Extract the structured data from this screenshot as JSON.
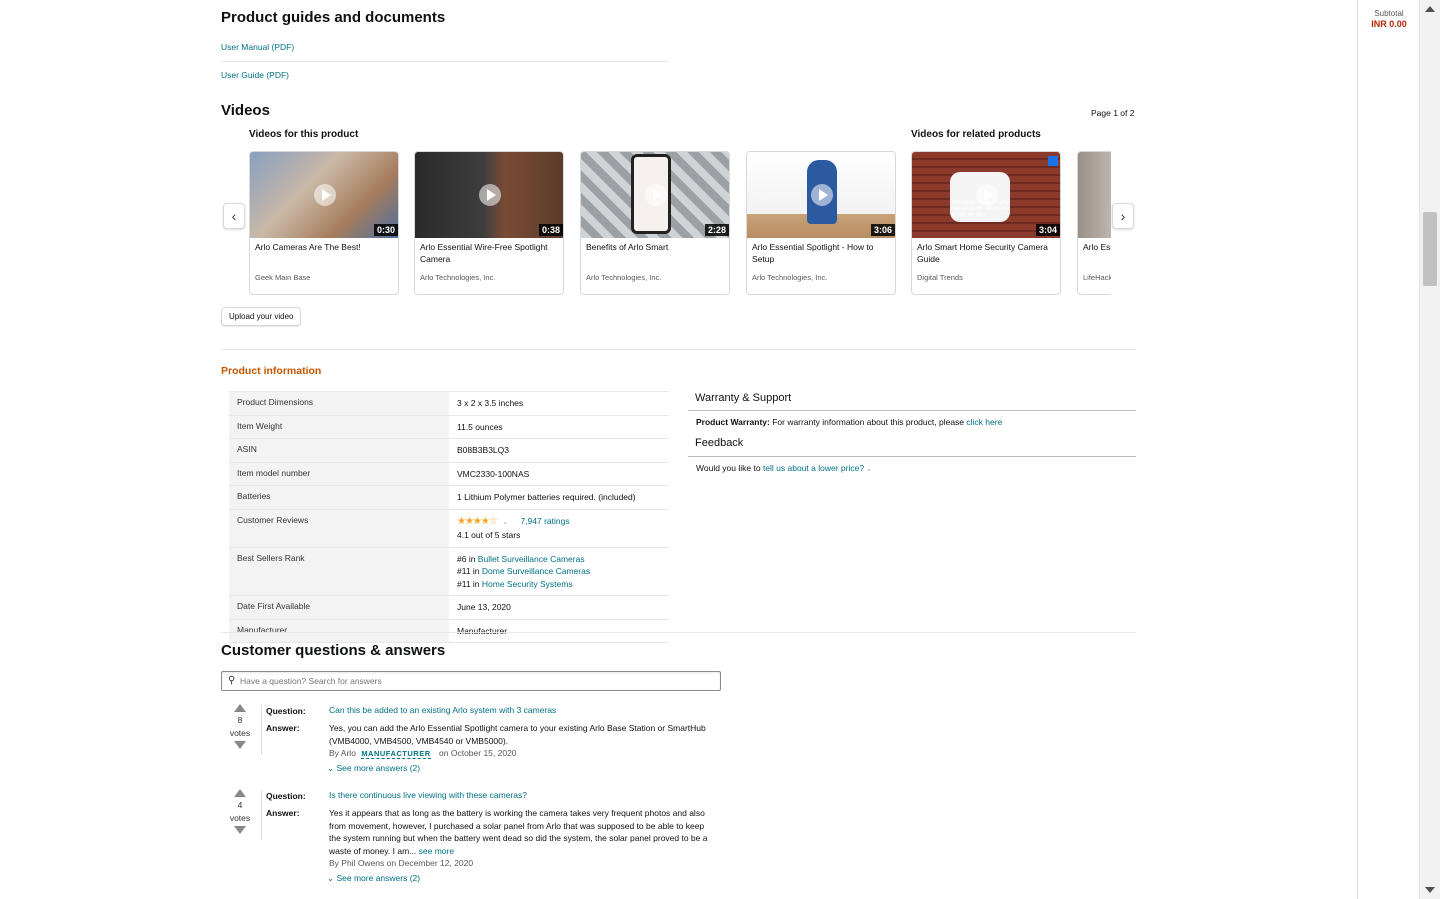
{
  "guides": {
    "title": "Product guides and documents",
    "links": [
      "User Manual (PDF)",
      "User Guide (PDF)"
    ]
  },
  "videos": {
    "title": "Videos",
    "page": "Page 1 of 2",
    "section_product": "Videos for this product",
    "section_related": "Videos for related products",
    "items": [
      {
        "title": "Arlo Cameras Are The Best!",
        "by": "Geek Main Base",
        "duration": "0:30"
      },
      {
        "title": "Arlo Essential Wire-Free Spotlight Camera",
        "by": "Arlo Technologies, Inc.",
        "duration": "0:38"
      },
      {
        "title": "Benefits of Arlo Smart",
        "by": "Arlo Technologies, Inc.",
        "duration": "2:28"
      },
      {
        "title": "Arlo Essential Spotlight - How to Setup",
        "by": "Arlo Technologies, Inc.",
        "duration": "3:06"
      },
      {
        "title": "Arlo Smart Home Security Camera Guide",
        "by": "Digital Trends",
        "duration": "3:04"
      },
      {
        "title": "Arlo Essential Camera",
        "by": "LifeHacker",
        "duration": ""
      }
    ],
    "thumb_overlay_text": "Arlo Smart Home security camera guide: Which one is right for you?",
    "upload_label": "Upload your video"
  },
  "product_info": {
    "title": "Product information",
    "rows": [
      {
        "key": "Product Dimensions",
        "value": "3 x 2 x 3.5 inches"
      },
      {
        "key": "Item Weight",
        "value": "11.5 ounces"
      },
      {
        "key": "ASIN",
        "value": "B08B3B3LQ3"
      },
      {
        "key": "Item model number",
        "value": "VMC2330-100NAS"
      },
      {
        "key": "Batteries",
        "value": "1 Lithium Polymer batteries required. (included)"
      }
    ],
    "reviews": {
      "key": "Customer Reviews",
      "stars": "★★★★☆",
      "ratings": "7,947 ratings",
      "summary": "4.1 out of 5 stars",
      "rating_value": 4.1
    },
    "rank": {
      "key": "Best Sellers Rank",
      "items": [
        {
          "rank": "#6 in ",
          "category": "Bullet Surveillance Cameras"
        },
        {
          "rank": "#11 in ",
          "category": "Dome Surveillance Cameras"
        },
        {
          "rank": "#11 in ",
          "category": "Home Security Systems"
        }
      ]
    },
    "rows_after": [
      {
        "key": "Date First Available",
        "value": "June 13, 2020"
      },
      {
        "key": "Manufacturer",
        "value": "Manufacturer"
      }
    ]
  },
  "warranty": {
    "title": "Warranty & Support",
    "label": "Product Warranty:",
    "text": " For warranty information about this product, please ",
    "link": "click here"
  },
  "feedback": {
    "title": "Feedback",
    "text": "Would you like to ",
    "link": "tell us about a lower price?"
  },
  "qa": {
    "title": "Customer questions & answers",
    "search_placeholder": "Have a question? Search for answers",
    "question_label": "Question:",
    "answer_label": "Answer:",
    "items": [
      {
        "votes": "8",
        "votes_label": "votes",
        "question": "Can this be added to an existing Arlo system with 3 cameras",
        "answer": "Yes, you can add the Arlo Essential Spotlight camera to your existing Arlo Base Station or SmartHub (VMB4000, VMB4500, VMB4540 or VMB5000).",
        "by": "By Arlo",
        "badge": "MANUFACTURER",
        "date": "on October 15, 2020",
        "more": "See more answers (2)"
      },
      {
        "votes": "4",
        "votes_label": "votes",
        "question": "Is there continuous live viewing with these cameras?",
        "answer": "Yes it appears that as long as the battery is working the camera takes very frequent photos and also from movement, however, I purchased a solar panel from Arlo that was supposed to be able to keep the system running but when the battery went dead so did the system, the solar panel proved to be a waste of money. I am...",
        "see_more": "see more",
        "by": "By Phil Owens on December 12, 2020",
        "more": "See more answers (2)"
      }
    ]
  },
  "subtotal": {
    "label": "Subtotal",
    "amount": "INR 0.00"
  }
}
